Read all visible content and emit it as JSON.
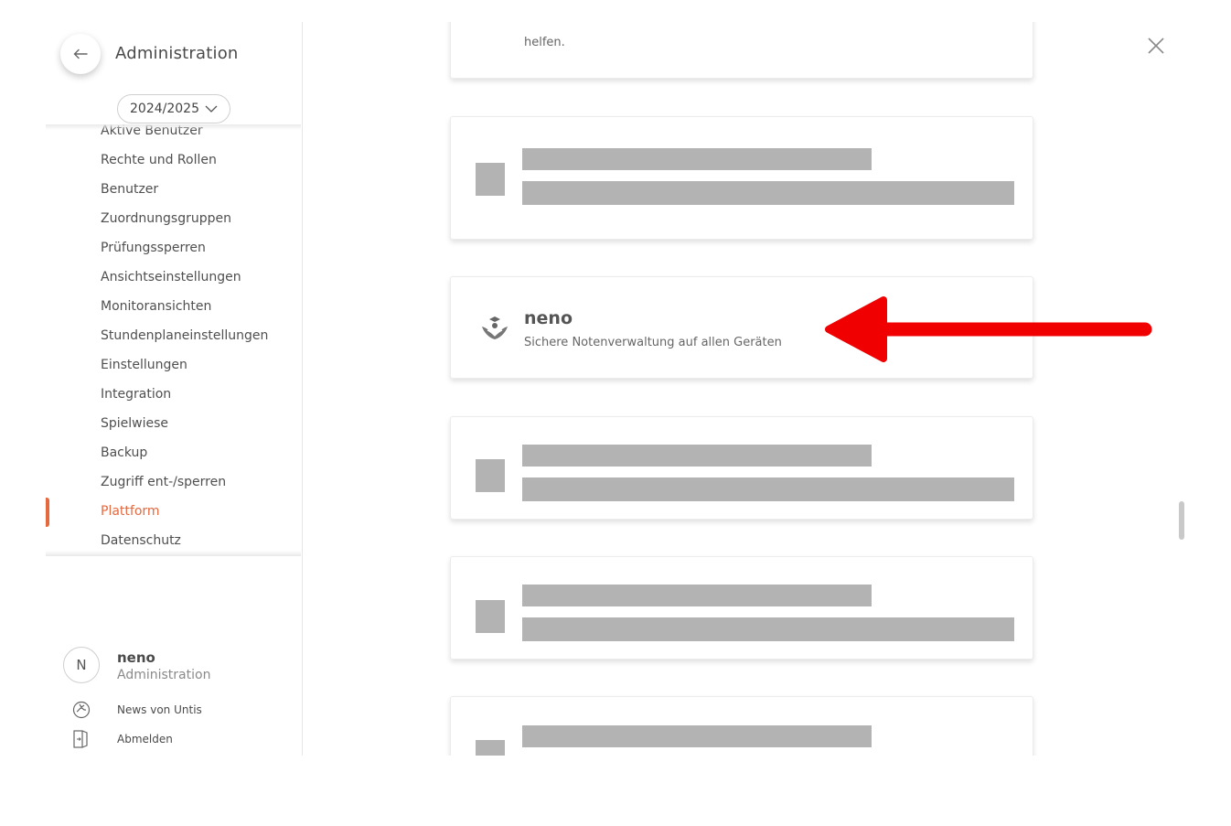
{
  "sidebar": {
    "title": "Administration",
    "year": "2024/2025",
    "items": [
      {
        "label": "Aktive Benutzer"
      },
      {
        "label": "Rechte und Rollen"
      },
      {
        "label": "Benutzer"
      },
      {
        "label": "Zuordnungsgruppen"
      },
      {
        "label": "Prüfungssperren"
      },
      {
        "label": "Ansichtseinstellungen"
      },
      {
        "label": "Monitoransichten"
      },
      {
        "label": "Stundenplaneinstellungen"
      },
      {
        "label": "Einstellungen"
      },
      {
        "label": "Integration"
      },
      {
        "label": "Spielwiese"
      },
      {
        "label": "Backup"
      },
      {
        "label": "Zugriff ent-/sperren"
      },
      {
        "label": "Plattform",
        "active": true
      },
      {
        "label": "Datenschutz"
      }
    ],
    "user": {
      "initial": "N",
      "name": "neno",
      "role": "Administration"
    },
    "links": {
      "news": "News von Untis",
      "logout": "Abmelden"
    }
  },
  "main": {
    "top_card_text": "helfen.",
    "featured": {
      "title": "neno",
      "subtitle": "Sichere Notenverwaltung auf allen Geräten"
    }
  },
  "colors": {
    "accent": "#e5683f",
    "arrow": "#f00000",
    "placeholder": "#b3b3b3"
  }
}
